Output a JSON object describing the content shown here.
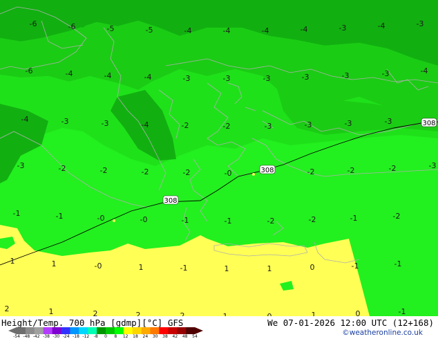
{
  "map": {
    "contour_labels": [
      "308",
      "308",
      "308"
    ],
    "temp_values": [
      [
        "-6",
        "-6",
        "-5",
        "-5",
        "-4",
        "-4",
        "-4",
        "-4",
        "-3",
        "-4",
        "-3"
      ],
      [
        "-6",
        "-4",
        "-4",
        "-4",
        "-3",
        "-3",
        "-3",
        "-3",
        "-3",
        "-3",
        "-4"
      ],
      [
        "-4",
        "-3",
        "-3",
        "-4",
        "-2",
        "-2",
        "-3",
        "-3",
        "-3",
        "-3"
      ],
      [
        "-3",
        "-2",
        "-2",
        "-2",
        "-2",
        "-0",
        "-2",
        "-2",
        "-2",
        "-3"
      ],
      [
        "-1",
        "-1",
        "-0",
        "-0",
        "-1",
        "-1",
        "-2",
        "-2",
        "-1",
        "-2"
      ],
      [
        "1",
        "1",
        "-0",
        "1",
        "-1",
        "1",
        "1",
        "0",
        "-1",
        "-1"
      ],
      [
        "2",
        "1",
        "2",
        "2",
        "2",
        "1",
        "0",
        "1",
        "0",
        "-1"
      ]
    ],
    "colors": {
      "dark_green": "#11b010",
      "mid_green": "#1bcc14",
      "green": "#1fe11a",
      "bright_green": "#23f01f",
      "yellow": "#ffff55",
      "coast": "#b0b0b0",
      "contour": "#000000"
    }
  },
  "footer": {
    "title": "Height/Temp. 700 hPa [gdmp][°C] GFS",
    "datetime": "We 07-01-2026 12:00 UTC (12+168)",
    "copyright": "©weatheronline.co.uk",
    "colorbar_labels": [
      "-54",
      "-48",
      "-42",
      "-38",
      "-30",
      "-24",
      "-18",
      "-12",
      "-8",
      "0",
      "8",
      "12",
      "18",
      "24",
      "30",
      "38",
      "42",
      "48",
      "54"
    ],
    "colorbar_colors": [
      "#6e6e6e",
      "#8c8c8c",
      "#a0a0a0",
      "#b43cff",
      "#7f00d0",
      "#3232ff",
      "#0096ff",
      "#00d7ff",
      "#00ffb4",
      "#009600",
      "#00c800",
      "#00ff00",
      "#ffff00",
      "#ffd700",
      "#ffaa00",
      "#ff7800",
      "#ff0000",
      "#c80000",
      "#960000",
      "#500000"
    ]
  }
}
